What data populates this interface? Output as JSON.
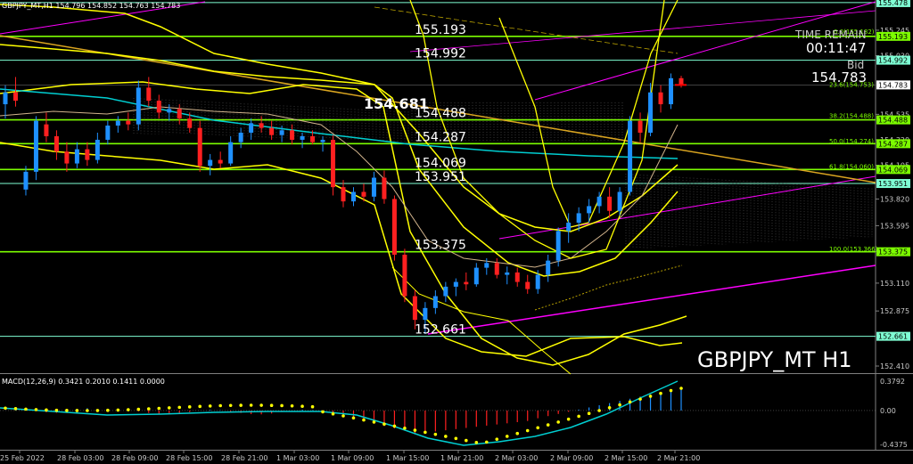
{
  "header": {
    "symbol_line": "GBPJPY_MT,H1  154.796 154.852 154.763 154.783"
  },
  "watermark": "GBPJPY_MT H1",
  "timer": {
    "label": "TIME REMAIN",
    "value": "00:11:47",
    "bid_label": "Bid",
    "bid_value": "154.783"
  },
  "price_levels": [
    {
      "label": "155.193",
      "price": 155.193,
      "axis": "155.193"
    },
    {
      "label": "154.992",
      "price": 154.992,
      "axis": "154.992"
    },
    {
      "label": "154.488",
      "price": 154.488,
      "axis": "154.488"
    },
    {
      "label": "154.287",
      "price": 154.287,
      "axis": "154.287"
    },
    {
      "label": "154.069",
      "price": 154.069,
      "axis": "154.069"
    },
    {
      "label": "153.951",
      "price": 153.951,
      "axis": "153.951"
    },
    {
      "label": "153.375",
      "price": 153.375,
      "axis": "153.375"
    },
    {
      "label": "152.661",
      "price": 152.661,
      "axis": "152.661"
    }
  ],
  "top_level": {
    "price": 155.478,
    "axis": "155.478"
  },
  "current_price": {
    "price": 154.783,
    "axis": "154.783"
  },
  "highlight_price": "154.681",
  "fibonacci": [
    {
      "label": "23.6(154.753)",
      "price": 154.753
    },
    {
      "label": "38.2(154.488)",
      "price": 154.488
    },
    {
      "label": "50.0(154.274)",
      "price": 154.274
    },
    {
      "label": "61.8(154.060)",
      "price": 154.06
    },
    {
      "label": "100.0(153.366)",
      "price": 153.366
    }
  ],
  "fib_top_partial": "0.0(155.182)",
  "axis_ticks": [
    "155.245",
    "155.030",
    "154.535",
    "154.320",
    "154.105",
    "153.820",
    "153.595",
    "153.110",
    "152.875",
    "152.410"
  ],
  "x_ticks": [
    "25 Feb 2022",
    "28 Feb 03:00",
    "28 Feb 09:00",
    "28 Feb 15:00",
    "28 Feb 21:00",
    "1 Mar 03:00",
    "1 Mar 09:00",
    "1 Mar 15:00",
    "1 Mar 21:00",
    "2 Mar 03:00",
    "2 Mar 09:00",
    "2 Mar 15:00",
    "2 Mar 21:00"
  ],
  "macd": {
    "label": "MACD(12,26,9) 0.3421 0.2010 0.1411 0.0000",
    "ticks": [
      "0.3792",
      "0.00",
      "-0.4375"
    ],
    "ylim": [
      -0.4375,
      0.3792
    ]
  },
  "chart_data": {
    "type": "candlestick",
    "ylim": [
      152.35,
      155.5
    ],
    "candles": [
      {
        "o": 154.62,
        "h": 154.78,
        "l": 154.5,
        "c": 154.72
      },
      {
        "o": 154.72,
        "h": 154.85,
        "l": 154.6,
        "c": 154.65
      },
      {
        "o": 153.9,
        "h": 154.1,
        "l": 153.85,
        "c": 154.05
      },
      {
        "o": 154.05,
        "h": 154.52,
        "l": 153.98,
        "c": 154.48
      },
      {
        "o": 154.45,
        "h": 154.55,
        "l": 154.3,
        "c": 154.35
      },
      {
        "o": 154.35,
        "h": 154.4,
        "l": 154.15,
        "c": 154.22
      },
      {
        "o": 154.22,
        "h": 154.3,
        "l": 154.05,
        "c": 154.12
      },
      {
        "o": 154.12,
        "h": 154.3,
        "l": 154.08,
        "c": 154.24
      },
      {
        "o": 154.24,
        "h": 154.3,
        "l": 154.1,
        "c": 154.15
      },
      {
        "o": 154.15,
        "h": 154.38,
        "l": 154.12,
        "c": 154.32
      },
      {
        "o": 154.32,
        "h": 154.48,
        "l": 154.28,
        "c": 154.44
      },
      {
        "o": 154.44,
        "h": 154.52,
        "l": 154.38,
        "c": 154.48
      },
      {
        "o": 154.48,
        "h": 154.55,
        "l": 154.4,
        "c": 154.45
      },
      {
        "o": 154.45,
        "h": 154.82,
        "l": 154.4,
        "c": 154.76
      },
      {
        "o": 154.76,
        "h": 154.85,
        "l": 154.6,
        "c": 154.65
      },
      {
        "o": 154.65,
        "h": 154.7,
        "l": 154.5,
        "c": 154.55
      },
      {
        "o": 154.55,
        "h": 154.62,
        "l": 154.48,
        "c": 154.58
      },
      {
        "o": 154.58,
        "h": 154.62,
        "l": 154.45,
        "c": 154.5
      },
      {
        "o": 154.5,
        "h": 154.55,
        "l": 154.38,
        "c": 154.42
      },
      {
        "o": 154.42,
        "h": 154.48,
        "l": 154.05,
        "c": 154.1
      },
      {
        "o": 154.1,
        "h": 154.2,
        "l": 154.02,
        "c": 154.15
      },
      {
        "o": 154.15,
        "h": 154.22,
        "l": 154.08,
        "c": 154.12
      },
      {
        "o": 154.12,
        "h": 154.35,
        "l": 154.1,
        "c": 154.3
      },
      {
        "o": 154.3,
        "h": 154.42,
        "l": 154.25,
        "c": 154.38
      },
      {
        "o": 154.38,
        "h": 154.5,
        "l": 154.32,
        "c": 154.46
      },
      {
        "o": 154.46,
        "h": 154.52,
        "l": 154.38,
        "c": 154.42
      },
      {
        "o": 154.42,
        "h": 154.48,
        "l": 154.32,
        "c": 154.36
      },
      {
        "o": 154.36,
        "h": 154.44,
        "l": 154.3,
        "c": 154.4
      },
      {
        "o": 154.4,
        "h": 154.45,
        "l": 154.28,
        "c": 154.32
      },
      {
        "o": 154.32,
        "h": 154.38,
        "l": 154.25,
        "c": 154.35
      },
      {
        "o": 154.35,
        "h": 154.4,
        "l": 154.28,
        "c": 154.3
      },
      {
        "o": 154.3,
        "h": 154.35,
        "l": 154.22,
        "c": 154.32
      },
      {
        "o": 154.32,
        "h": 154.36,
        "l": 153.85,
        "c": 153.92
      },
      {
        "o": 153.92,
        "h": 153.98,
        "l": 153.75,
        "c": 153.8
      },
      {
        "o": 153.8,
        "h": 153.92,
        "l": 153.76,
        "c": 153.88
      },
      {
        "o": 153.88,
        "h": 153.95,
        "l": 153.8,
        "c": 153.84
      },
      {
        "o": 153.84,
        "h": 154.05,
        "l": 153.8,
        "c": 154.0
      },
      {
        "o": 154.0,
        "h": 154.06,
        "l": 153.78,
        "c": 153.82
      },
      {
        "o": 153.82,
        "h": 153.85,
        "l": 153.3,
        "c": 153.35
      },
      {
        "o": 153.35,
        "h": 153.4,
        "l": 152.95,
        "c": 153.0
      },
      {
        "o": 153.0,
        "h": 153.05,
        "l": 152.72,
        "c": 152.8
      },
      {
        "o": 152.8,
        "h": 152.95,
        "l": 152.68,
        "c": 152.9
      },
      {
        "o": 152.9,
        "h": 153.05,
        "l": 152.85,
        "c": 153.0
      },
      {
        "o": 153.0,
        "h": 153.12,
        "l": 152.95,
        "c": 153.08
      },
      {
        "o": 153.08,
        "h": 153.15,
        "l": 153.0,
        "c": 153.12
      },
      {
        "o": 153.12,
        "h": 153.2,
        "l": 153.05,
        "c": 153.1
      },
      {
        "o": 153.1,
        "h": 153.28,
        "l": 153.08,
        "c": 153.24
      },
      {
        "o": 153.24,
        "h": 153.32,
        "l": 153.18,
        "c": 153.28
      },
      {
        "o": 153.28,
        "h": 153.32,
        "l": 153.15,
        "c": 153.18
      },
      {
        "o": 153.18,
        "h": 153.25,
        "l": 153.1,
        "c": 153.2
      },
      {
        "o": 153.2,
        "h": 153.24,
        "l": 153.08,
        "c": 153.12
      },
      {
        "o": 153.12,
        "h": 153.18,
        "l": 153.02,
        "c": 153.06
      },
      {
        "o": 153.06,
        "h": 153.22,
        "l": 153.02,
        "c": 153.18
      },
      {
        "o": 153.18,
        "h": 153.35,
        "l": 153.12,
        "c": 153.3
      },
      {
        "o": 153.3,
        "h": 153.58,
        "l": 153.25,
        "c": 153.55
      },
      {
        "o": 153.55,
        "h": 153.7,
        "l": 153.45,
        "c": 153.62
      },
      {
        "o": 153.62,
        "h": 153.75,
        "l": 153.55,
        "c": 153.7
      },
      {
        "o": 153.7,
        "h": 153.82,
        "l": 153.62,
        "c": 153.76
      },
      {
        "o": 153.76,
        "h": 153.88,
        "l": 153.7,
        "c": 153.84
      },
      {
        "o": 153.84,
        "h": 153.92,
        "l": 153.66,
        "c": 153.72
      },
      {
        "o": 153.72,
        "h": 153.92,
        "l": 153.68,
        "c": 153.88
      },
      {
        "o": 153.88,
        "h": 154.52,
        "l": 153.85,
        "c": 154.48
      },
      {
        "o": 154.48,
        "h": 154.55,
        "l": 154.3,
        "c": 154.38
      },
      {
        "o": 154.38,
        "h": 154.8,
        "l": 154.35,
        "c": 154.72
      },
      {
        "o": 154.72,
        "h": 154.78,
        "l": 154.55,
        "c": 154.62
      },
      {
        "o": 154.62,
        "h": 154.88,
        "l": 154.58,
        "c": 154.84
      },
      {
        "o": 154.84,
        "h": 154.86,
        "l": 154.76,
        "c": 154.783
      }
    ],
    "xlabel": "",
    "ylabel": ""
  }
}
